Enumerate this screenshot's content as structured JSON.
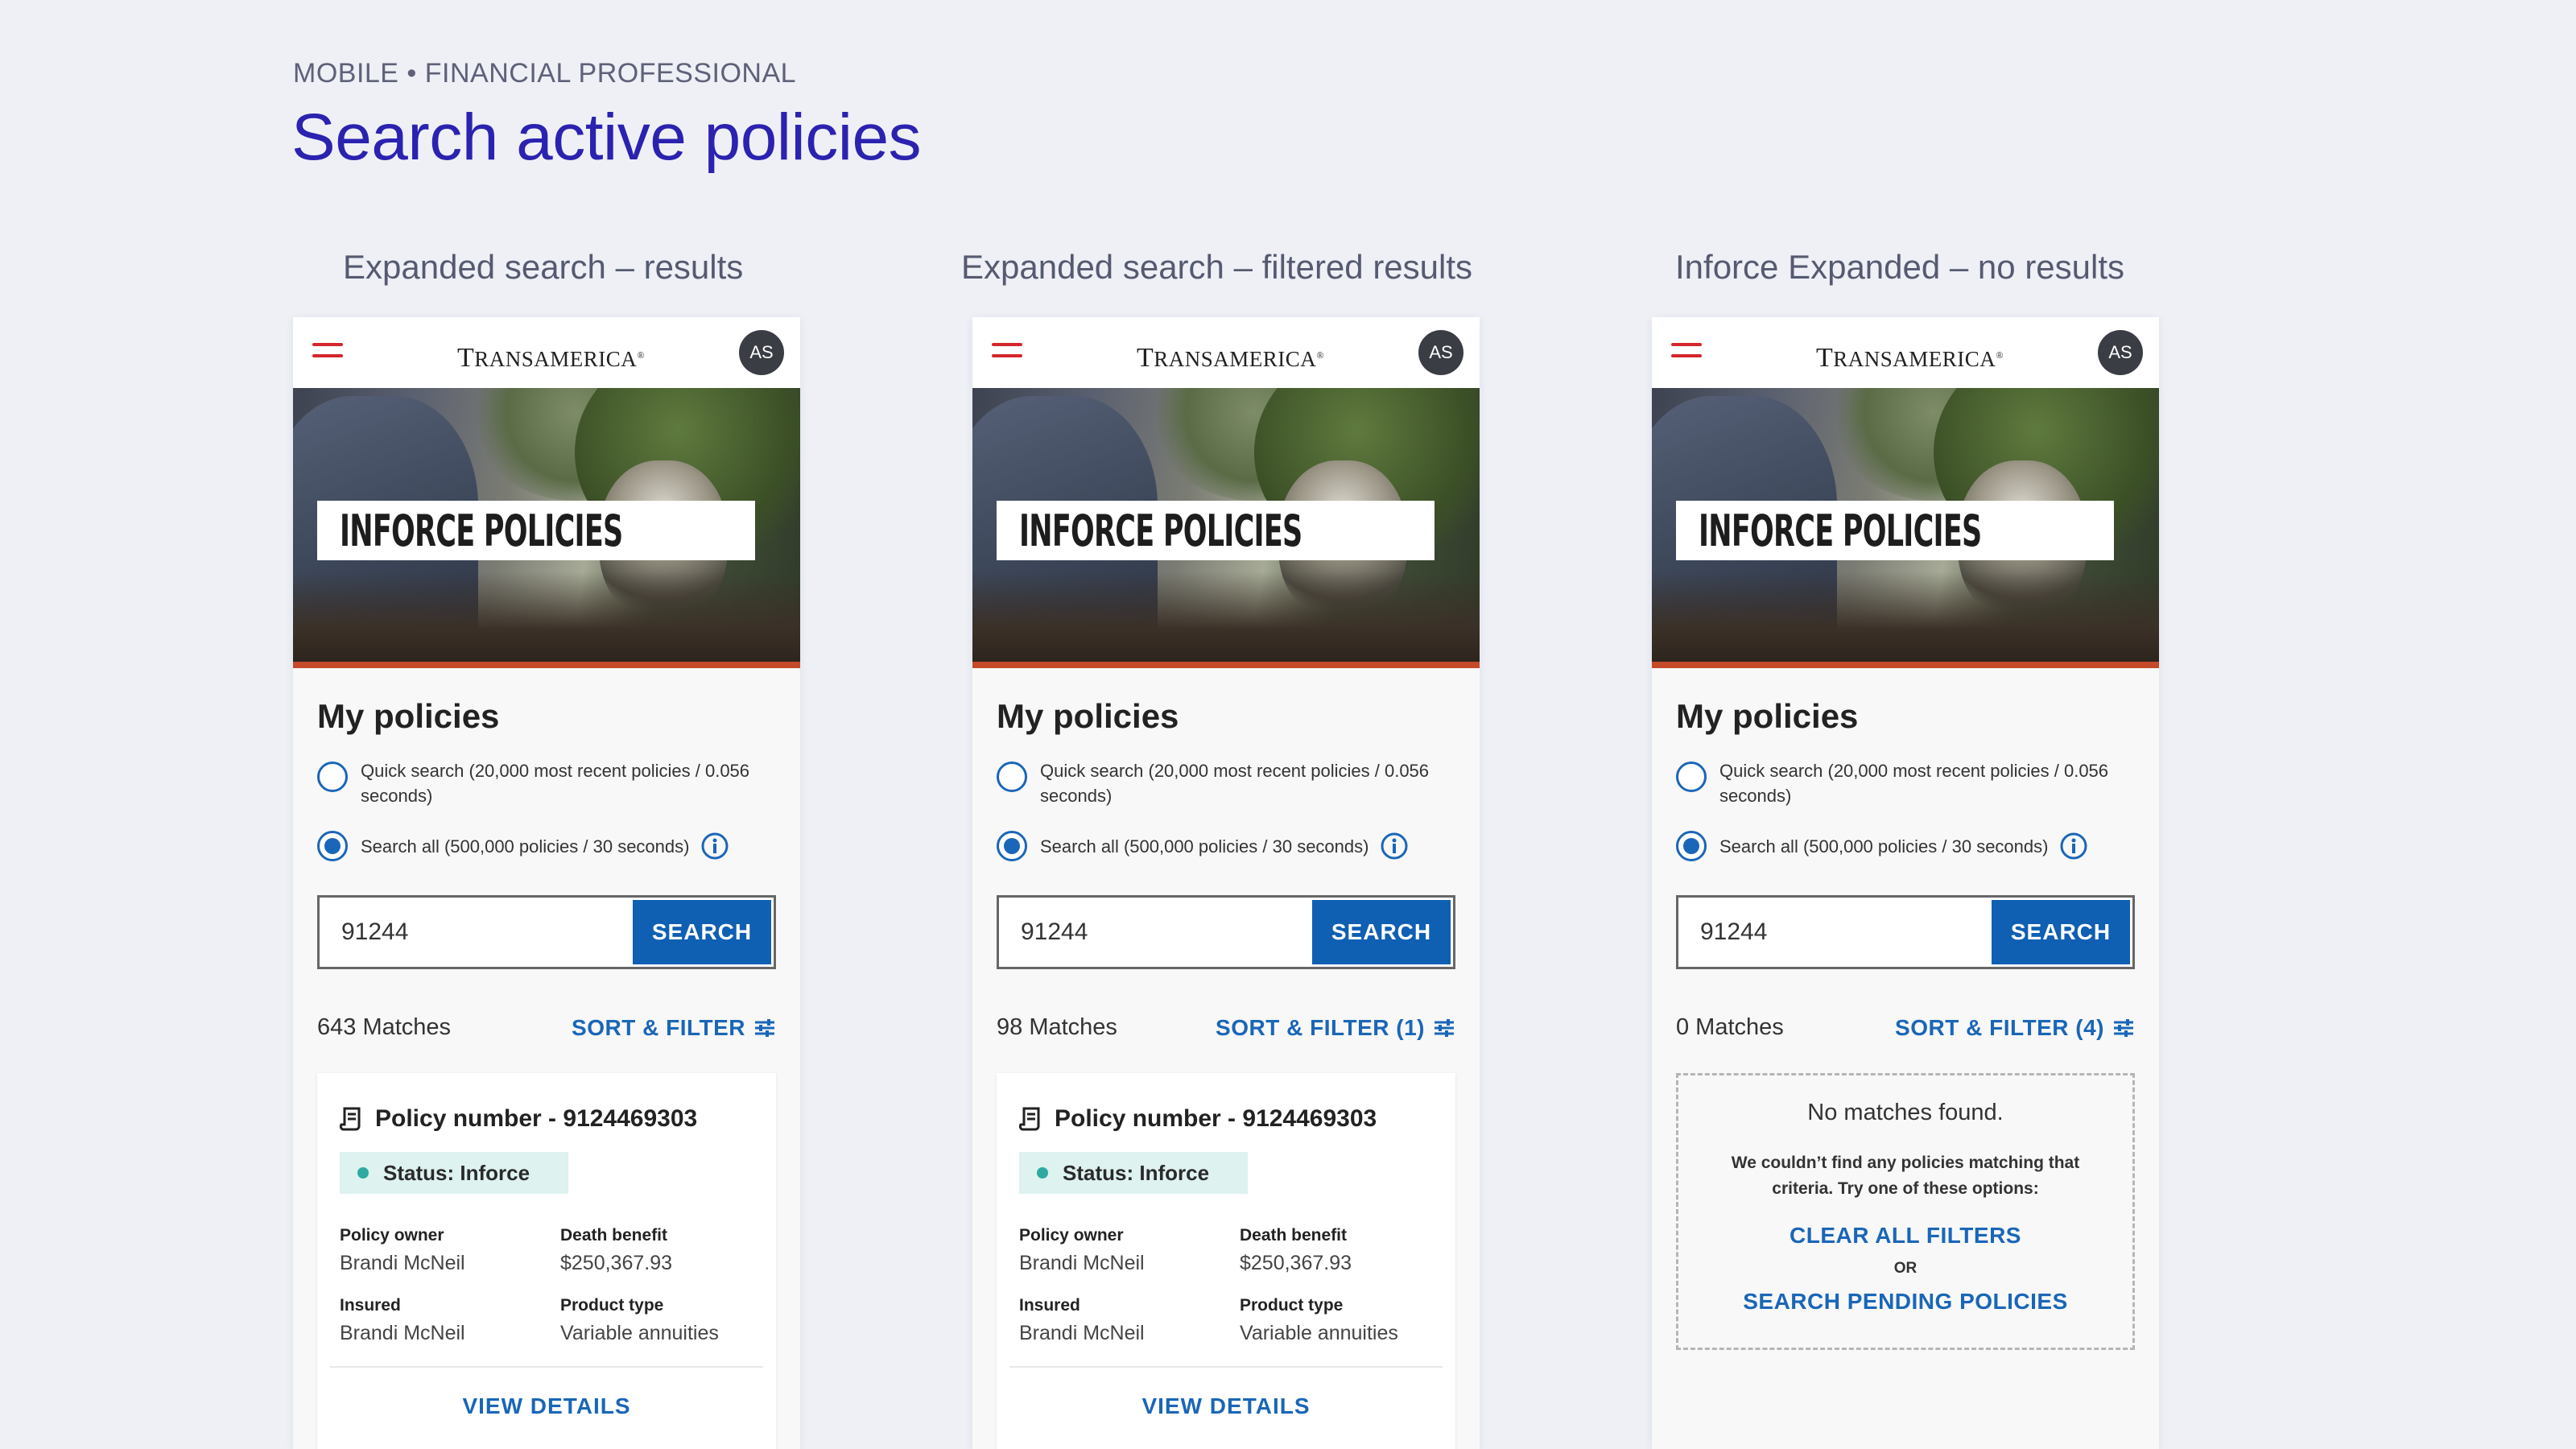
{
  "header": {
    "eyebrow": "MOBILE • FINANCIAL PROFESSIONAL",
    "title": "Search active policies"
  },
  "colors": {
    "title": "#2b22b0",
    "link": "#1a66b8",
    "search_button": "#0f5fb3",
    "hamburger": "#d4262c",
    "status_dot": "#2fa9a1",
    "status_bg": "#def2f0"
  },
  "shared": {
    "logo_first": "T",
    "logo_rest": "RANSAMERICA",
    "logo_mark": "®",
    "avatar": "AS",
    "hero_banner": "INFORCE POLICIES",
    "section_title": "My policies",
    "quick_search_label": "Quick search (20,000 most recent policies / 0.056 seconds)",
    "search_all_label": "Search all (500,000 policies / 30 seconds)",
    "search_value": "91244",
    "search_button": "SEARCH",
    "icons": {
      "menu": "hamburger-icon",
      "info": "info-icon",
      "filter": "sliders-icon",
      "policy": "document-icon"
    }
  },
  "screens": [
    {
      "caption": "Expanded search – results",
      "matches": "643 Matches",
      "sort_filter": "SORT & FILTER",
      "card": {
        "policy_number": "Policy number - 9124469303",
        "status": "Status: Inforce",
        "owner_label": "Policy owner",
        "owner": "Brandi McNeil",
        "death_benefit_label": "Death benefit",
        "death_benefit": "$250,367.93",
        "insured_label": "Insured",
        "insured": "Brandi McNeil",
        "product_type_label": "Product type",
        "product_type": "Variable annuities",
        "view_details": "VIEW DETAILS"
      }
    },
    {
      "caption": "Expanded search – filtered results",
      "matches": "98 Matches",
      "sort_filter": "SORT & FILTER (1)",
      "card": {
        "policy_number": "Policy number - 9124469303",
        "status": "Status: Inforce",
        "owner_label": "Policy owner",
        "owner": "Brandi McNeil",
        "death_benefit_label": "Death benefit",
        "death_benefit": "$250,367.93",
        "insured_label": "Insured",
        "insured": "Brandi McNeil",
        "product_type_label": "Product type",
        "product_type": "Variable annuities",
        "view_details": "VIEW DETAILS"
      }
    },
    {
      "caption": "Inforce Expanded – no results",
      "matches": "0 Matches",
      "sort_filter": "SORT & FILTER (4)",
      "no_results": {
        "title": "No matches found.",
        "body": "We couldn’t find any policies matching that criteria.  Try one of these options:",
        "clear_filters": "CLEAR ALL FILTERS",
        "or": "OR",
        "search_pending": "SEARCH PENDING POLICIES"
      }
    }
  ]
}
